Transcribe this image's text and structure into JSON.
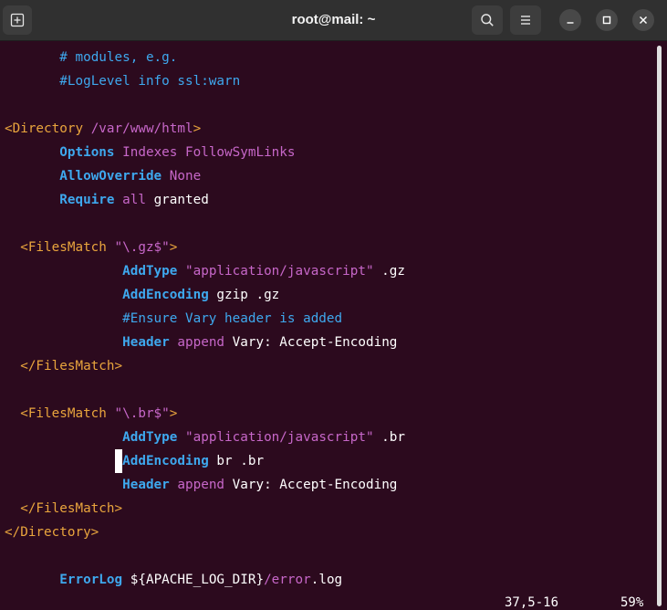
{
  "window": {
    "title": "root@mail: ~",
    "buttons": [
      "new-tab",
      "search",
      "menu",
      "minimize",
      "maximize",
      "close"
    ]
  },
  "terminal": {
    "lines": [
      [
        {
          "t": "       ",
          "c": "txt"
        },
        {
          "t": "# modules, e.g.",
          "c": "com"
        }
      ],
      [
        {
          "t": "       ",
          "c": "txt"
        },
        {
          "t": "#LogLevel info ssl:warn",
          "c": "com"
        }
      ],
      [],
      [
        {
          "t": "<Directory ",
          "c": "tag"
        },
        {
          "t": "/var/www/html",
          "c": "str"
        },
        {
          "t": ">",
          "c": "tag"
        }
      ],
      [
        {
          "t": "       ",
          "c": "txt"
        },
        {
          "t": "Options",
          "c": "kw"
        },
        {
          "t": " Indexes FollowSymLinks",
          "c": "str"
        }
      ],
      [
        {
          "t": "       ",
          "c": "txt"
        },
        {
          "t": "AllowOverride",
          "c": "kw"
        },
        {
          "t": " None",
          "c": "str"
        }
      ],
      [
        {
          "t": "       ",
          "c": "txt"
        },
        {
          "t": "Require",
          "c": "kw"
        },
        {
          "t": " all",
          "c": "str"
        },
        {
          "t": " granted",
          "c": "txt"
        }
      ],
      [],
      [
        {
          "t": "  ",
          "c": "txt"
        },
        {
          "t": "<FilesMatch ",
          "c": "tag"
        },
        {
          "t": "\"\\.gz$\"",
          "c": "str"
        },
        {
          "t": ">",
          "c": "tag"
        }
      ],
      [
        {
          "t": "               ",
          "c": "txt"
        },
        {
          "t": "AddType",
          "c": "kw"
        },
        {
          "t": " \"application/javascript\"",
          "c": "str"
        },
        {
          "t": " .gz",
          "c": "txt"
        }
      ],
      [
        {
          "t": "               ",
          "c": "txt"
        },
        {
          "t": "AddEncoding",
          "c": "kw"
        },
        {
          "t": " gzip .gz",
          "c": "txt"
        }
      ],
      [
        {
          "t": "               ",
          "c": "txt"
        },
        {
          "t": "#Ensure Vary header is added",
          "c": "com"
        }
      ],
      [
        {
          "t": "               ",
          "c": "txt"
        },
        {
          "t": "Header",
          "c": "kw"
        },
        {
          "t": " append",
          "c": "str"
        },
        {
          "t": " Vary: Accept-Encoding",
          "c": "txt"
        }
      ],
      [
        {
          "t": "  ",
          "c": "txt"
        },
        {
          "t": "</FilesMatch>",
          "c": "tag"
        }
      ],
      [],
      [
        {
          "t": "  ",
          "c": "txt"
        },
        {
          "t": "<FilesMatch ",
          "c": "tag"
        },
        {
          "t": "\"\\.br$\"",
          "c": "str"
        },
        {
          "t": ">",
          "c": "tag"
        }
      ],
      [
        {
          "t": "               ",
          "c": "txt"
        },
        {
          "t": "AddType",
          "c": "kw"
        },
        {
          "t": " \"application/javascript\"",
          "c": "str"
        },
        {
          "t": " .br",
          "c": "txt"
        }
      ],
      [
        {
          "t": "              ",
          "c": "txt"
        },
        {
          "t": " ",
          "c": "cursor"
        },
        {
          "t": "AddEncoding",
          "c": "kw"
        },
        {
          "t": " br .br",
          "c": "txt"
        }
      ],
      [
        {
          "t": "               ",
          "c": "txt"
        },
        {
          "t": "Header",
          "c": "kw"
        },
        {
          "t": " append",
          "c": "str"
        },
        {
          "t": " Vary: Accept-Encoding",
          "c": "txt"
        }
      ],
      [
        {
          "t": "  ",
          "c": "txt"
        },
        {
          "t": "</FilesMatch>",
          "c": "tag"
        }
      ],
      [
        {
          "t": "</Directory>",
          "c": "tag"
        }
      ],
      [],
      [
        {
          "t": "       ",
          "c": "txt"
        },
        {
          "t": "ErrorLog",
          "c": "kw"
        },
        {
          "t": " ${APACHE_LOG_DIR}",
          "c": "txt"
        },
        {
          "t": "/error",
          "c": "str"
        },
        {
          "t": ".log",
          "c": "txt"
        }
      ]
    ],
    "status": {
      "position": "37,5-16",
      "percent": "59%"
    }
  },
  "colors": {
    "background": "#2c0a1e",
    "tag": "#e9a53d",
    "keyword": "#3ea8ee",
    "string": "#c767c9",
    "comment": "#3ea8ee",
    "text": "#ffffff"
  }
}
